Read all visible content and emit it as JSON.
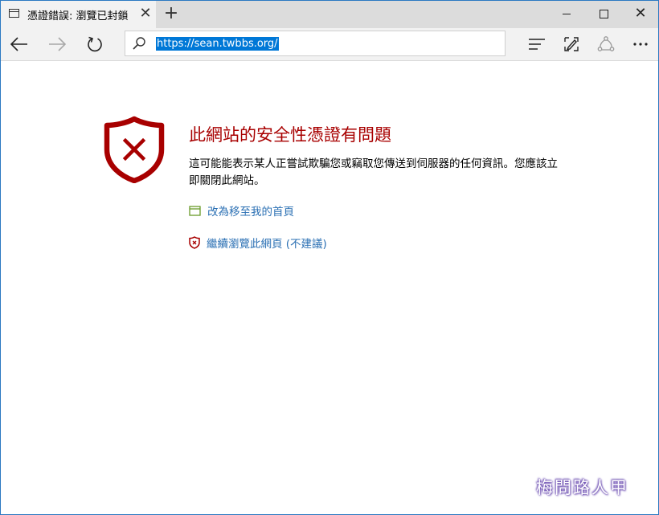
{
  "tab": {
    "title": "憑證錯誤: 瀏覽已封鎖"
  },
  "address_bar": {
    "url": "https://sean.twbbs.org/"
  },
  "error_page": {
    "headline": "此網站的安全性憑證有問題",
    "description": "這可能能表示某人正嘗試欺騙您或竊取您傳送到伺服器的任何資訊。您應該立即關閉此網站。",
    "go_home_link": "改為移至我的首頁",
    "continue_link": "繼續瀏覽此網頁 (不建議)"
  },
  "watermark": {
    "text": "梅問路人甲"
  },
  "colors": {
    "accent": "#0078d7",
    "error_red": "#a80000",
    "link_blue": "#2a6fb3",
    "home_icon_green": "#6a9a2a"
  }
}
